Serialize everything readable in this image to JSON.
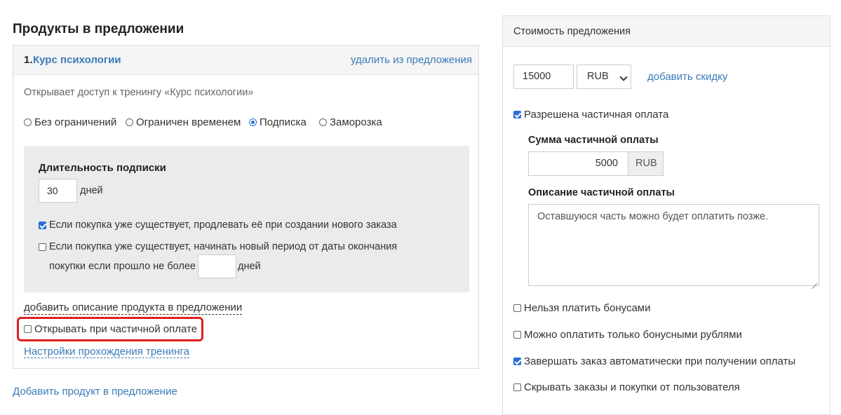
{
  "products": {
    "title": "Продукты в предложении",
    "item": {
      "number": "1.",
      "name": "Курс психологии",
      "remove_label": "удалить из предложения",
      "access_text": "Открывает доступ к тренингу «Курс психологии»",
      "access_options": [
        {
          "label": "Без ограничений",
          "selected": false
        },
        {
          "label": "Ограничен временем",
          "selected": false
        },
        {
          "label": "Подписка",
          "selected": true
        },
        {
          "label": "Заморозка",
          "selected": false
        }
      ],
      "subscription": {
        "duration_label": "Длительность подписки",
        "duration_value": "30",
        "duration_unit": "дней",
        "extend_label": "Если покупка уже существует, продлевать её при создании нового заказа",
        "extend_checked": true,
        "new_period_label_line1": "Если покупка уже существует, начинать новый период от даты окончания",
        "new_period_label_line2": "покупки если прошло не более",
        "new_period_checked": false,
        "new_period_value": "",
        "new_period_unit": "дней"
      },
      "add_description_label": "добавить описание продукта в предложении",
      "open_on_partial_label": "Открывать при частичной оплате",
      "open_on_partial_checked": false,
      "training_settings_label": "Настройки прохождения тренинга"
    },
    "add_product_label": "Добавить продукт в предложение"
  },
  "cost": {
    "title": "Стоимость предложения",
    "price": "15000",
    "currency": "RUB",
    "add_discount_label": "добавить скидку",
    "partial_allowed_label": "Разрешена частичная оплата",
    "partial_allowed_checked": true,
    "partial_sum_label": "Сумма частичной оплаты",
    "partial_sum_value": "5000",
    "partial_sum_currency": "RUB",
    "partial_desc_label": "Описание частичной оплаты",
    "partial_desc_value": "Оставшуюся часть можно будет оплатить позже.",
    "options": {
      "no_bonus": {
        "label": "Нельзя платить бонусами",
        "checked": false
      },
      "only_bonus": {
        "label": "Можно оплатить только бонусными рублями",
        "checked": false
      },
      "auto_finish": {
        "label": "Завершать заказ автоматически при получении оплаты",
        "checked": true
      },
      "hide_orders": {
        "label": "Скрывать заказы и покупки от пользователя",
        "checked": false
      }
    }
  },
  "colors": {
    "link": "#3a7bb8",
    "highlight": "#e02020",
    "checkbox": "#2a6fd6",
    "panel_header": "#f5f5f5",
    "subscription_box": "#ebebeb"
  }
}
